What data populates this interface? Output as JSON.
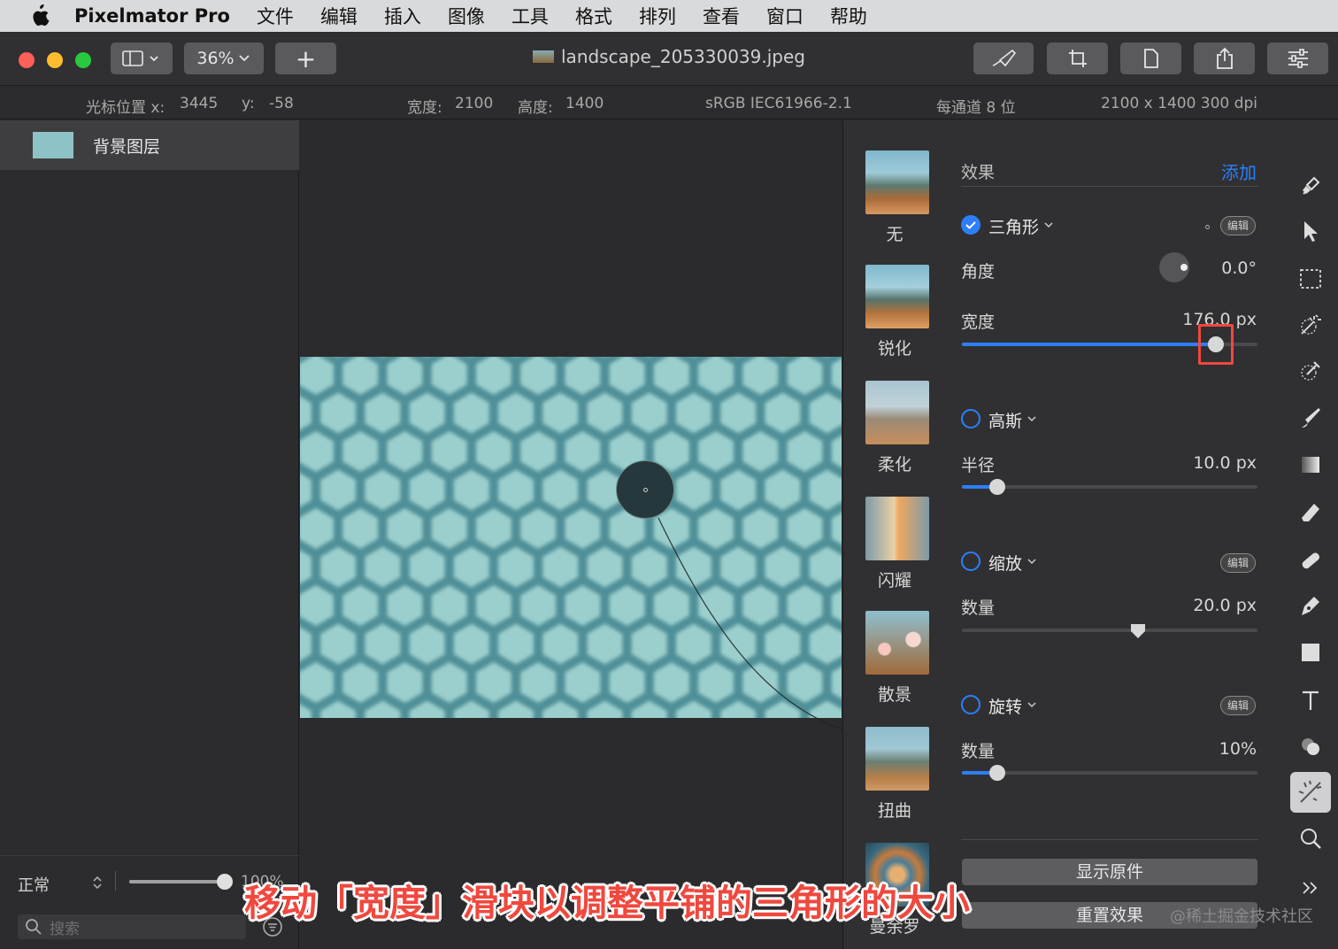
{
  "menubar": {
    "items": [
      "Pixelmator Pro",
      "文件",
      "编辑",
      "插入",
      "图像",
      "工具",
      "格式",
      "排列",
      "查看",
      "窗口",
      "帮助"
    ]
  },
  "toolbar": {
    "zoom": "36%",
    "add_label": "+",
    "document_title": "landscape_205330039.jpeg"
  },
  "infobar": {
    "cursor_x_label": "光标位置 x:",
    "cursor_x": "3445",
    "cursor_y_label": "y:",
    "cursor_y": "-58",
    "width_label": "宽度:",
    "width": "2100",
    "height_label": "高度:",
    "height": "1400",
    "color_profile": "sRGB IEC61966-2.1",
    "bit_depth": "每通道 8 位",
    "size_dpi": "2100 x 1400 300 dpi"
  },
  "layers": {
    "items": [
      {
        "name": "背景图层"
      }
    ],
    "blend_mode": "正常",
    "opacity_text": "100%",
    "opacity": 1.0,
    "search_placeholder": "搜索"
  },
  "effect_presets": [
    "无",
    "锐化",
    "柔化",
    "闪耀",
    "散景",
    "扭曲",
    "曼余罗"
  ],
  "panel": {
    "title": "效果",
    "add_label": "添加",
    "edit_label": "编辑",
    "groups": [
      {
        "name": "三角形",
        "checked": true,
        "has_edit": true,
        "params": [
          {
            "label": "角度",
            "value": "0.0°",
            "kind": "dial"
          },
          {
            "label": "宽度",
            "value": "176.0 px",
            "kind": "slider",
            "fraction": 0.86
          }
        ]
      },
      {
        "name": "高斯",
        "checked": false,
        "has_edit": false,
        "params": [
          {
            "label": "半径",
            "value": "10.0 px",
            "kind": "slider",
            "fraction": 0.12
          }
        ]
      },
      {
        "name": "缩放",
        "checked": false,
        "has_edit": true,
        "params": [
          {
            "label": "数量",
            "value": "20.0 px",
            "kind": "center-slider",
            "fraction": 0.595
          }
        ]
      },
      {
        "name": "旋转",
        "checked": false,
        "has_edit": true,
        "params": [
          {
            "label": "数量",
            "value": "10%",
            "kind": "slider",
            "fraction": 0.12
          }
        ]
      }
    ],
    "show_original_label": "显示原件",
    "reset_label": "重置效果"
  },
  "caption": "移动「宽度」滑块以调整平铺的三角形的大小",
  "watermark": "@稀土掘金技术社区",
  "colors": {
    "accent": "#2d7ff9",
    "caption": "#f0483e",
    "tile": "#9bcfcd",
    "tile_edge": "#4f8f97"
  }
}
